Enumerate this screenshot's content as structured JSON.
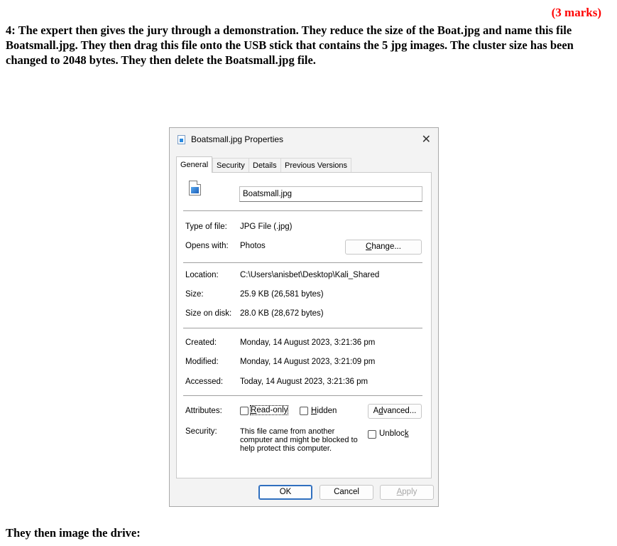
{
  "document": {
    "marks": "(3 marks)",
    "question": "4: The expert then gives the jury through a demonstration. They reduce the size of the Boat.jpg and name this file Boatsmall.jpg. They then drag this file onto the USB stick that contains the 5 jpg images. The cluster size has been changed to 2048 bytes. They then delete the Boatsmall.jpg file.",
    "footer": "They then image the drive:"
  },
  "dialog": {
    "title": "Boatsmall.jpg Properties",
    "close_glyph": "✕",
    "tabs": [
      {
        "label": "General"
      },
      {
        "label": "Security"
      },
      {
        "label": "Details"
      },
      {
        "label": "Previous Versions"
      }
    ],
    "file_name": "Boatsmall.jpg",
    "type_label": "Type of file:",
    "type_value": "JPG File (.jpg)",
    "opens_label": "Opens with:",
    "opens_value": "Photos",
    "change_pre": "",
    "change_ul": "C",
    "change_post": "hange...",
    "location_label": "Location:",
    "location_value": "C:\\Users\\anisbet\\Desktop\\Kali_Shared",
    "size_label": "Size:",
    "size_value": "25.9 KB (26,581 bytes)",
    "disk_label": "Size on disk:",
    "disk_value": "28.0 KB (28,672 bytes)",
    "created_label": "Created:",
    "created_value": "Monday, 14 August 2023, 3:21:36 pm",
    "modified_label": "Modified:",
    "modified_value": "Monday, 14 August 2023, 3:21:09 pm",
    "accessed_label": "Accessed:",
    "accessed_value": "Today, 14 August 2023, 3:21:36 pm",
    "attributes_label": "Attributes:",
    "readonly_ul": "R",
    "readonly_post": "ead-only",
    "hidden_ul": "H",
    "hidden_post": "idden",
    "advanced_pre": "A",
    "advanced_ul": "d",
    "advanced_post": "vanced...",
    "security_label": "Security:",
    "security_text": "This file came from another computer and might be blocked to help protect this computer.",
    "unblock_pre": "Unbloc",
    "unblock_ul": "k",
    "ok_label": "OK",
    "cancel_label": "Cancel",
    "apply_pre": "",
    "apply_ul": "A",
    "apply_post": "pply"
  }
}
